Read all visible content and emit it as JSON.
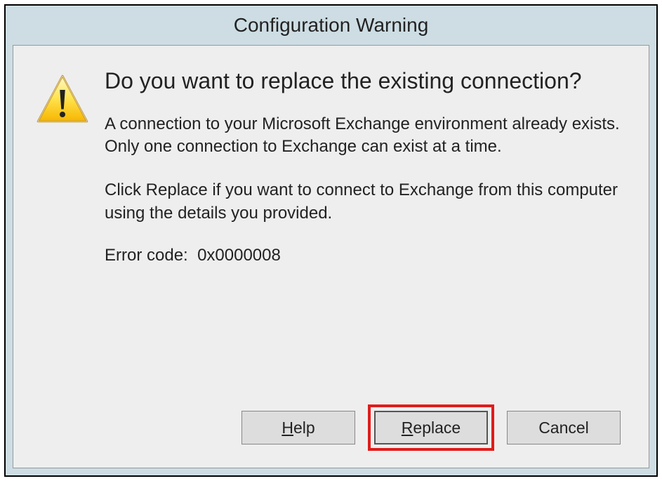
{
  "dialog": {
    "title": "Configuration Warning",
    "icon": "warning-triangle-icon",
    "heading": "Do you want to replace the existing connection?",
    "body1": "A connection to your Microsoft Exchange environment already exists. Only one connection to Exchange can exist at a time.",
    "body2": "Click Replace if you want to connect to Exchange from this computer using the details you provided.",
    "error_label": "Error code:",
    "error_code": "0x0000008",
    "buttons": {
      "help": "Help",
      "replace": "Replace",
      "cancel": "Cancel"
    }
  }
}
